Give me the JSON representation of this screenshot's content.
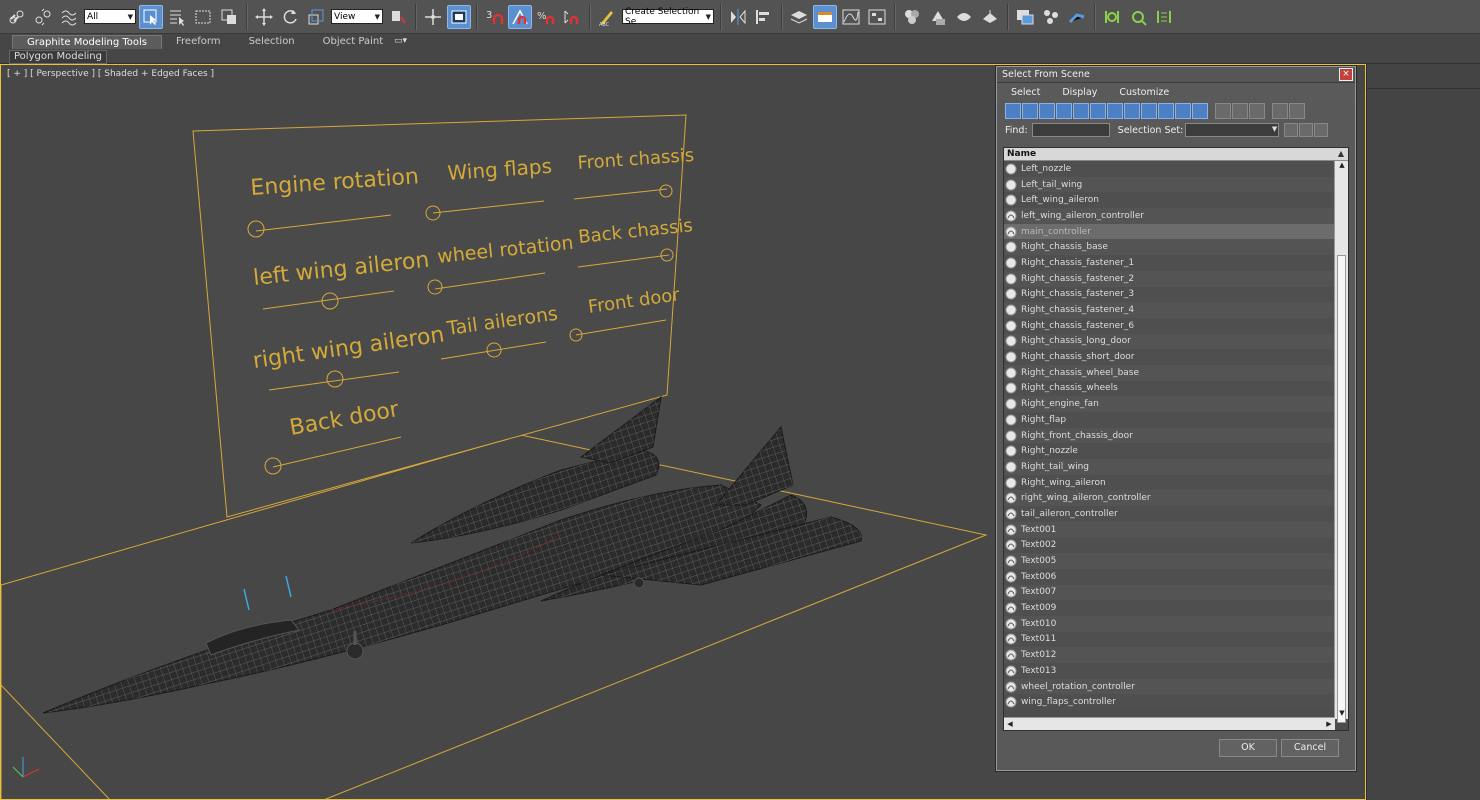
{
  "toolbar": {
    "selection_filter": "All",
    "reference_coord": "View",
    "named_selection_placeholder": "Create Selection Se",
    "icons": [
      "link-icon",
      "unlink-icon",
      "bind-spacewarp-icon",
      "select-object-icon",
      "select-by-name-icon",
      "rect-selection-icon",
      "window-crossing-icon",
      "move-icon",
      "rotate-icon",
      "scale-icon",
      "pivot-icon",
      "manipulate-icon",
      "snap-3d-icon",
      "angle-snap-icon",
      "percent-snap-icon",
      "spinner-snap-icon",
      "edit-named-sets-icon",
      "mirror-icon",
      "align-icon",
      "layer-manager-icon",
      "graphite-toggle-icon",
      "curve-editor-icon",
      "schematic-view-icon",
      "material-editor-icon",
      "render-setup-icon",
      "rendered-frame-icon",
      "render-icon",
      "render-iterative-icon",
      "scene-explorer-icon",
      "toggle-ribbon-icon",
      "particle-view-icon",
      "ik-solver-icon",
      "set-key-icon",
      "auto-key-icon"
    ]
  },
  "ribbon": {
    "tabs": [
      {
        "label": "Graphite Modeling Tools",
        "active": true
      },
      {
        "label": "Freeform",
        "active": false
      },
      {
        "label": "Selection",
        "active": false
      },
      {
        "label": "Object Paint",
        "active": false
      }
    ],
    "sub_panel": "Polygon Modeling"
  },
  "viewport": {
    "label": "[ + ] [ Perspective ] [ Shaded + Edged Faces ]",
    "panel_texts": {
      "engine_rotation": "Engine rotation",
      "wing_flaps": "Wing flaps",
      "front_chassis": "Front chassis",
      "left_wing_aileron": "left wing aileron",
      "wheel_rotation": "wheel rotation",
      "back_chassis": "Back chassis",
      "right_wing_aileron": "right wing aileron",
      "tail_ailerons": "Tail ailerons",
      "front_door": "Front door",
      "back_door": "Back door"
    },
    "accent_color": "#e8c23c",
    "text_color": "#d4aa38"
  },
  "dialog": {
    "title": "Select From Scene",
    "close_label": "×",
    "menu": [
      "Select",
      "Display",
      "Customize"
    ],
    "find_label": "Find:",
    "selection_set_label": "Selection Set:",
    "column_header": "Name",
    "items": [
      {
        "name": "Left_nozzle",
        "icon": "geometry-icon"
      },
      {
        "name": "Left_tail_wing",
        "icon": "geometry-icon"
      },
      {
        "name": "Left_wing_aileron",
        "icon": "geometry-icon"
      },
      {
        "name": "left_wing_aileron_controller",
        "icon": "shape-icon"
      },
      {
        "name": "main_controller",
        "icon": "shape-icon",
        "selected": true
      },
      {
        "name": "Right_chassis_base",
        "icon": "geometry-icon"
      },
      {
        "name": "Right_chassis_fastener_1",
        "icon": "geometry-icon"
      },
      {
        "name": "Right_chassis_fastener_2",
        "icon": "geometry-icon"
      },
      {
        "name": "Right_chassis_fastener_3",
        "icon": "geometry-icon"
      },
      {
        "name": "Right_chassis_fastener_4",
        "icon": "geometry-icon"
      },
      {
        "name": "Right_chassis_fastener_6",
        "icon": "geometry-icon"
      },
      {
        "name": "Right_chassis_long_door",
        "icon": "geometry-icon"
      },
      {
        "name": "Right_chassis_short_door",
        "icon": "geometry-icon"
      },
      {
        "name": "Right_chassis_wheel_base",
        "icon": "geometry-icon"
      },
      {
        "name": "Right_chassis_wheels",
        "icon": "geometry-icon"
      },
      {
        "name": "Right_engine_fan",
        "icon": "geometry-icon"
      },
      {
        "name": "Right_flap",
        "icon": "geometry-icon"
      },
      {
        "name": "Right_front_chassis_door",
        "icon": "geometry-icon"
      },
      {
        "name": "Right_nozzle",
        "icon": "geometry-icon"
      },
      {
        "name": "Right_tail_wing",
        "icon": "geometry-icon"
      },
      {
        "name": "Right_wing_aileron",
        "icon": "geometry-icon"
      },
      {
        "name": "right_wing_aileron_controller",
        "icon": "shape-icon"
      },
      {
        "name": "tail_aileron_controller",
        "icon": "shape-icon"
      },
      {
        "name": "Text001",
        "icon": "shape-icon"
      },
      {
        "name": "Text002",
        "icon": "shape-icon"
      },
      {
        "name": "Text005",
        "icon": "shape-icon"
      },
      {
        "name": "Text006",
        "icon": "shape-icon"
      },
      {
        "name": "Text007",
        "icon": "shape-icon"
      },
      {
        "name": "Text009",
        "icon": "shape-icon"
      },
      {
        "name": "Text010",
        "icon": "shape-icon"
      },
      {
        "name": "Text011",
        "icon": "shape-icon"
      },
      {
        "name": "Text012",
        "icon": "shape-icon"
      },
      {
        "name": "Text013",
        "icon": "shape-icon"
      },
      {
        "name": "wheel_rotation_controller",
        "icon": "shape-icon"
      },
      {
        "name": "wing_flaps_controller",
        "icon": "shape-icon"
      }
    ],
    "ok_label": "OK",
    "cancel_label": "Cancel"
  }
}
